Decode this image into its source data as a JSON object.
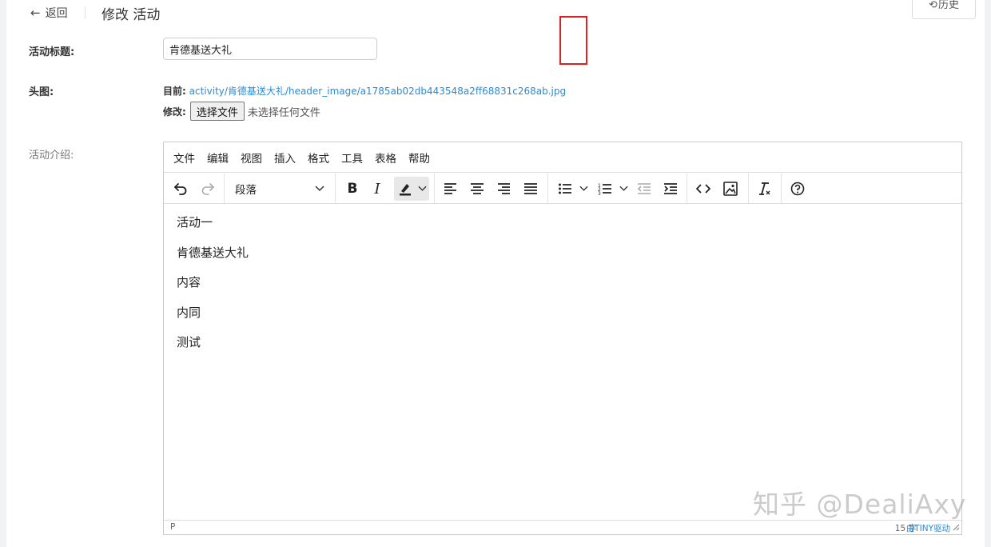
{
  "header": {
    "back_label": "返回",
    "page_title": "修改 活动",
    "history_label": "历史"
  },
  "form": {
    "title_label": "活动标题:",
    "title_value": "肯德基送大礼",
    "image_label": "头图:",
    "current_label": "目前:",
    "current_path": "activity/肯德基送大礼/header_image/a1785ab02db443548a2ff68831c268ab.jpg",
    "modify_label": "修改:",
    "choose_file": "选择文件",
    "no_file": "未选择任何文件",
    "intro_label": "活动介绍:"
  },
  "editor": {
    "menus": [
      "文件",
      "编辑",
      "视图",
      "插入",
      "格式",
      "工具",
      "表格",
      "帮助"
    ],
    "block_format": "段落",
    "paragraphs": [
      "活动一",
      "肯德基送大礼",
      "内容",
      "内同",
      "测试"
    ],
    "status_path": "P",
    "word_count": "15 字",
    "brand": "由TINY驱动",
    "highlighted_tool": "image-icon"
  },
  "watermark": "知乎 @DealiAxy"
}
